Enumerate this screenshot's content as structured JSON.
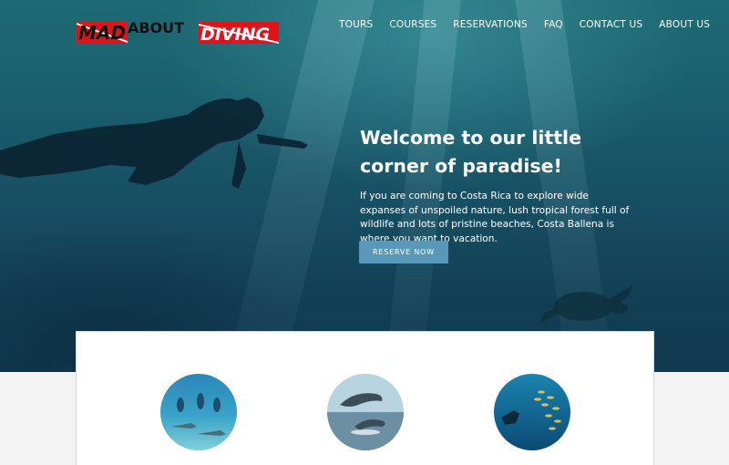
{
  "header": {
    "logo_text": "MADABOUTDIVING",
    "nav": [
      "TOURS",
      "COURSES",
      "RESERVATIONS",
      "FAQ",
      "CONTACT US",
      "ABOUT US"
    ]
  },
  "hero": {
    "title": "Welcome to our little corner of paradise!",
    "text": "If you are coming to Costa Rica to explore wide expanses of unspoiled nature, lush tropical forest full of wildlife and lots of pristine beaches, Costa Ballena is where you want to vacation.",
    "button_label": "RESERVE NOW"
  },
  "features": {
    "images": [
      "divers-with-sharks-image",
      "dolphins-image",
      "diver-with-fish-school-image"
    ]
  },
  "colors": {
    "accent": "#5a98ba",
    "hero_water": "#174e62",
    "logo_red": "#e2121b"
  }
}
